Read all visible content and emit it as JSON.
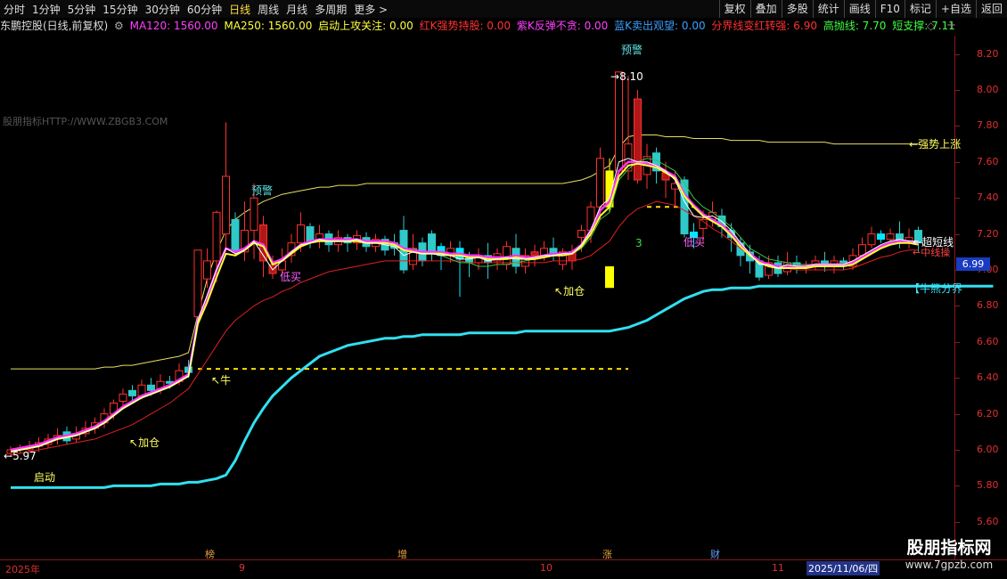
{
  "toolbar": {
    "periods": [
      "分时",
      "1分钟",
      "5分钟",
      "15分钟",
      "30分钟",
      "60分钟",
      "日线",
      "周线",
      "月线",
      "多周期",
      "更多"
    ],
    "active_period": "日线",
    "right_buttons": [
      "复权",
      "叠加",
      "多股",
      "统计",
      "画线",
      "F10",
      "标记",
      "+自选",
      "返回"
    ]
  },
  "info": {
    "symbol": "东鹏控股(日线,前复权)",
    "ma120": "MA120: 1560.00",
    "ma250": "MA250: 1560.00",
    "qidong": "启动上攻关注: 0.00",
    "hongk": "红K强势持股: 0.00",
    "zik": "紫K反弹不贪: 0.00",
    "lank": "蓝K卖出观望: 0.00",
    "fenjie": "分界线变红转强: 6.90",
    "gaopao": "高抛线: 7.70",
    "duanzhi": "短支撑: 7.11",
    "colors": {
      "ma120": "#ff40ff",
      "ma250": "#ffff40",
      "qidong": "#ffff40",
      "hongk": "#ff3030",
      "zik": "#ff40ff",
      "lank": "#3aa0ff",
      "fenjie": "#ff3030",
      "gaopao": "#40ff40",
      "duanzhi": "#40ff40"
    }
  },
  "watermark": "股朋指标HTTP://WWW.ZBGB3.COM",
  "price_tag": "6.99",
  "x_labels": [
    "2025年",
    "9",
    "10",
    "11"
  ],
  "date_label": "2025/11/06/四",
  "events": [
    "榜",
    "增",
    "涨",
    "财"
  ],
  "annotations": {
    "yujing1": "预警",
    "yujing2": "预警",
    "dimai1": "低买",
    "dimai2": "低买",
    "jiacang1": "加仓",
    "jiacang2": "加仓",
    "niu": "牛",
    "qidong": "启动",
    "low_price": "5.97",
    "high_price": "8.10",
    "three": "3",
    "qiangshi": "强势上涨",
    "chaoduan": "超短线",
    "zhongxian": "中线操",
    "niuxiong": "牛熊分界"
  },
  "logo": {
    "line1": "股朋指标网",
    "line2": "www.7gpzb.com"
  },
  "chart_data": {
    "type": "candlestick",
    "ylim": [
      5.55,
      8.3
    ],
    "yticks": [
      "8.20",
      "8.00",
      "7.80",
      "7.60",
      "7.40",
      "7.20",
      "7.00",
      "6.80",
      "6.60",
      "6.40",
      "6.20",
      "6.00",
      "5.80",
      "5.60"
    ],
    "candles": [
      [
        5.98,
        6.0,
        5.96,
        6.02
      ],
      [
        6.0,
        6.01,
        5.98,
        6.03
      ],
      [
        6.0,
        6.02,
        5.98,
        6.05
      ],
      [
        6.02,
        6.04,
        5.99,
        6.07
      ],
      [
        6.03,
        6.06,
        6.01,
        6.09
      ],
      [
        6.06,
        6.08,
        6.03,
        6.12
      ],
      [
        6.1,
        6.05,
        6.03,
        6.13
      ],
      [
        6.06,
        6.09,
        6.04,
        6.13
      ],
      [
        6.09,
        6.12,
        6.07,
        6.16
      ],
      [
        6.12,
        6.15,
        6.09,
        6.18
      ],
      [
        6.15,
        6.2,
        6.12,
        6.23
      ],
      [
        6.2,
        6.26,
        6.17,
        6.28
      ],
      [
        6.27,
        6.31,
        6.24,
        6.34
      ],
      [
        6.33,
        6.3,
        6.27,
        6.36
      ],
      [
        6.3,
        6.36,
        6.28,
        6.39
      ],
      [
        6.36,
        6.33,
        6.3,
        6.4
      ],
      [
        6.34,
        6.38,
        6.31,
        6.42
      ],
      [
        6.38,
        6.37,
        6.34,
        6.41
      ],
      [
        6.38,
        6.44,
        6.36,
        6.48
      ],
      [
        6.46,
        6.43,
        6.4,
        6.5
      ],
      [
        6.74,
        7.11,
        6.74,
        7.11
      ],
      [
        6.95,
        7.05,
        6.9,
        7.12
      ],
      [
        7.05,
        7.32,
        6.93,
        7.33
      ],
      [
        7.2,
        7.52,
        7.1,
        7.82
      ],
      [
        7.28,
        7.11,
        7.08,
        7.32
      ],
      [
        7.1,
        7.22,
        7.05,
        7.38
      ],
      [
        7.22,
        7.4,
        7.06,
        7.48
      ],
      [
        7.25,
        7.05,
        6.96,
        7.3
      ],
      [
        7.03,
        6.98,
        6.95,
        7.08
      ],
      [
        7.0,
        7.05,
        6.97,
        7.12
      ],
      [
        7.08,
        7.15,
        7.04,
        7.2
      ],
      [
        7.15,
        7.25,
        7.1,
        7.32
      ],
      [
        7.24,
        7.16,
        7.12,
        7.26
      ],
      [
        7.16,
        7.2,
        7.12,
        7.25
      ],
      [
        7.2,
        7.14,
        7.1,
        7.22
      ],
      [
        7.14,
        7.18,
        7.1,
        7.22
      ],
      [
        7.18,
        7.15,
        7.1,
        7.2
      ],
      [
        7.15,
        7.19,
        7.11,
        7.22
      ],
      [
        7.18,
        7.13,
        7.1,
        7.21
      ],
      [
        7.13,
        7.17,
        7.1,
        7.2
      ],
      [
        7.17,
        7.11,
        7.08,
        7.19
      ],
      [
        7.15,
        7.12,
        7.08,
        7.2
      ],
      [
        7.22,
        7.0,
        6.98,
        7.3
      ],
      [
        7.03,
        7.12,
        7.0,
        7.2
      ],
      [
        7.15,
        7.05,
        7.02,
        7.18
      ],
      [
        7.2,
        7.1,
        7.05,
        7.22
      ],
      [
        7.13,
        7.08,
        7.0,
        7.15
      ],
      [
        7.08,
        7.12,
        7.04,
        7.16
      ],
      [
        7.12,
        7.06,
        6.85,
        7.16
      ],
      [
        7.08,
        7.04,
        6.96,
        7.1
      ],
      [
        7.04,
        7.08,
        7.0,
        7.12
      ],
      [
        7.08,
        7.04,
        6.95,
        7.15
      ],
      [
        7.05,
        7.09,
        7.0,
        7.12
      ],
      [
        7.03,
        7.13,
        7.0,
        7.16
      ],
      [
        7.12,
        7.02,
        6.98,
        7.2
      ],
      [
        7.02,
        7.08,
        6.98,
        7.12
      ],
      [
        7.1,
        7.08,
        7.02,
        7.14
      ],
      [
        7.08,
        7.12,
        7.05,
        7.16
      ],
      [
        7.12,
        7.08,
        7.05,
        7.18
      ],
      [
        7.03,
        7.1,
        7.0,
        7.12
      ],
      [
        7.05,
        7.1,
        7.0,
        7.14
      ],
      [
        7.18,
        7.22,
        7.1,
        7.25
      ],
      [
        7.22,
        7.35,
        7.15,
        7.38
      ],
      [
        7.35,
        7.62,
        7.28,
        7.68
      ],
      [
        7.35,
        7.55,
        7.32,
        7.62
      ],
      [
        7.55,
        8.1,
        7.52,
        8.1
      ],
      [
        7.55,
        7.7,
        7.5,
        8.08
      ],
      [
        7.95,
        7.5,
        7.48,
        8.0
      ],
      [
        7.53,
        7.63,
        7.45,
        7.7
      ],
      [
        7.65,
        7.55,
        7.48,
        7.68
      ],
      [
        7.5,
        7.54,
        7.4,
        7.6
      ],
      [
        7.45,
        7.48,
        7.35,
        7.55
      ],
      [
        7.5,
        7.2,
        7.18,
        7.52
      ],
      [
        7.21,
        7.18,
        7.12,
        7.26
      ],
      [
        7.23,
        7.28,
        7.15,
        7.33
      ],
      [
        7.28,
        7.32,
        7.24,
        7.38
      ],
      [
        7.3,
        7.24,
        7.18,
        7.34
      ],
      [
        7.22,
        7.18,
        7.1,
        7.26
      ],
      [
        7.15,
        7.08,
        7.02,
        7.18
      ],
      [
        7.1,
        7.05,
        6.98,
        7.14
      ],
      [
        7.05,
        6.96,
        6.94,
        7.08
      ],
      [
        6.97,
        7.04,
        6.95,
        7.08
      ],
      [
        7.04,
        6.98,
        6.96,
        7.08
      ],
      [
        6.99,
        7.04,
        6.97,
        7.1
      ],
      [
        7.04,
        7.01,
        6.98,
        7.08
      ],
      [
        7.01,
        7.02,
        6.98,
        7.05
      ],
      [
        7.02,
        7.05,
        7.0,
        7.08
      ],
      [
        7.05,
        7.03,
        6.99,
        7.1
      ],
      [
        7.03,
        7.05,
        6.98,
        7.08
      ],
      [
        7.05,
        7.04,
        7.0,
        7.07
      ],
      [
        7.02,
        7.08,
        7.0,
        7.12
      ],
      [
        7.08,
        7.14,
        7.06,
        7.18
      ],
      [
        7.14,
        7.2,
        7.12,
        7.24
      ],
      [
        7.2,
        7.17,
        7.15,
        7.22
      ],
      [
        7.17,
        7.2,
        7.14,
        7.23
      ],
      [
        7.2,
        7.15,
        7.12,
        7.27
      ],
      [
        7.15,
        7.18,
        7.12,
        7.23
      ],
      [
        7.22,
        7.15,
        7.1,
        7.24
      ]
    ],
    "colored": {
      "cyan": [
        46,
        48,
        73,
        93
      ],
      "red": [
        27,
        28,
        56,
        60,
        67,
        70
      ],
      "yellow": [
        64
      ]
    },
    "lines": {
      "magenta": [
        6.0,
        6.01,
        6.02,
        6.03,
        6.05,
        6.07,
        6.08,
        6.09,
        6.11,
        6.13,
        6.16,
        6.2,
        6.24,
        6.27,
        6.3,
        6.32,
        6.34,
        6.36,
        6.39,
        6.42,
        6.72,
        6.85,
        7.0,
        7.12,
        7.1,
        7.12,
        7.16,
        7.14,
        7.04,
        7.06,
        7.1,
        7.14,
        7.16,
        7.17,
        7.17,
        7.17,
        7.17,
        7.17,
        7.16,
        7.16,
        7.16,
        7.15,
        7.12,
        7.11,
        7.1,
        7.1,
        7.1,
        7.09,
        7.09,
        7.08,
        7.08,
        7.07,
        7.07,
        7.07,
        7.08,
        7.07,
        7.07,
        7.08,
        7.09,
        7.09,
        7.1,
        7.14,
        7.22,
        7.33,
        7.38,
        7.55,
        7.6,
        7.6,
        7.59,
        7.58,
        7.55,
        7.52,
        7.42,
        7.36,
        7.31,
        7.28,
        7.25,
        7.2,
        7.14,
        7.09,
        7.05,
        7.03,
        7.02,
        7.02,
        7.02,
        7.02,
        7.03,
        7.03,
        7.03,
        7.03,
        7.04,
        7.07,
        7.1,
        7.13,
        7.15,
        7.16,
        7.16,
        7.15
      ],
      "yellow": [
        5.99,
        6.0,
        6.01,
        6.02,
        6.04,
        6.06,
        6.07,
        6.08,
        6.1,
        6.12,
        6.15,
        6.19,
        6.23,
        6.26,
        6.29,
        6.31,
        6.33,
        6.35,
        6.38,
        6.41,
        6.7,
        6.82,
        6.96,
        7.09,
        7.08,
        7.11,
        7.15,
        7.13,
        7.03,
        7.05,
        7.09,
        7.13,
        7.15,
        7.16,
        7.16,
        7.16,
        7.16,
        7.16,
        7.15,
        7.15,
        7.15,
        7.14,
        7.11,
        7.1,
        7.09,
        7.09,
        7.09,
        7.08,
        7.08,
        7.07,
        7.07,
        7.06,
        7.06,
        7.06,
        7.07,
        7.06,
        7.06,
        7.07,
        7.08,
        7.08,
        7.09,
        7.13,
        7.2,
        7.3,
        7.35,
        7.52,
        7.58,
        7.59,
        7.58,
        7.57,
        7.54,
        7.51,
        7.41,
        7.35,
        7.3,
        7.27,
        7.24,
        7.19,
        7.13,
        7.08,
        7.04,
        7.02,
        7.01,
        7.01,
        7.01,
        7.01,
        7.02,
        7.02,
        7.02,
        7.02,
        7.03,
        7.06,
        7.09,
        7.12,
        7.14,
        7.15,
        7.15,
        7.14
      ],
      "white": [
        5.99,
        6.0,
        6.01,
        6.02,
        6.04,
        6.06,
        6.07,
        6.08,
        6.1,
        6.12,
        6.15,
        6.19,
        6.23,
        6.26,
        6.29,
        6.31,
        6.33,
        6.35,
        6.38,
        6.41,
        6.72,
        6.86,
        7.0,
        7.12,
        7.09,
        7.11,
        7.16,
        7.08,
        7.0,
        7.05,
        7.1,
        7.14,
        7.15,
        7.17,
        7.16,
        7.16,
        7.16,
        7.17,
        7.15,
        7.15,
        7.14,
        7.13,
        7.08,
        7.1,
        7.09,
        7.09,
        7.08,
        7.08,
        7.06,
        7.06,
        7.07,
        7.05,
        7.06,
        7.07,
        7.06,
        7.06,
        7.07,
        7.08,
        7.08,
        7.09,
        7.09,
        7.14,
        7.22,
        7.35,
        7.4,
        7.6,
        7.62,
        7.6,
        7.6,
        7.58,
        7.55,
        7.5,
        7.38,
        7.3,
        7.29,
        7.3,
        7.27,
        7.22,
        7.15,
        7.09,
        7.03,
        7.03,
        7.01,
        7.03,
        7.02,
        7.02,
        7.03,
        7.03,
        7.03,
        7.03,
        7.05,
        7.08,
        7.11,
        7.14,
        7.16,
        7.17,
        7.16,
        7.16
      ],
      "green": [
        null,
        null,
        null,
        null,
        null,
        null,
        null,
        null,
        null,
        null,
        null,
        null,
        null,
        null,
        null,
        null,
        null,
        null,
        null,
        null,
        null,
        null,
        null,
        null,
        null,
        null,
        null,
        null,
        null,
        null,
        null,
        null,
        null,
        null,
        null,
        null,
        null,
        null,
        null,
        null,
        null,
        null,
        null,
        7.12,
        7.1,
        7.09,
        7.08,
        7.06,
        7.04,
        7.04,
        7.02,
        7.02,
        7.03,
        7.03,
        7.04,
        7.05,
        7.06,
        7.07,
        7.08,
        7.08,
        7.09,
        7.12,
        7.18,
        7.28,
        7.32,
        7.5,
        7.56,
        7.6,
        7.62,
        7.61,
        7.58,
        7.55,
        7.48,
        7.4,
        7.35,
        7.32,
        7.28,
        7.24,
        7.18,
        7.12,
        7.09,
        7.06,
        7.05,
        7.04,
        7.03,
        7.03,
        7.03,
        7.03,
        7.03,
        7.03,
        7.04,
        7.06,
        7.09,
        7.12,
        7.14,
        7.15,
        7.15,
        7.14
      ],
      "red": [
        5.97,
        5.98,
        5.99,
        6.0,
        6.01,
        6.02,
        6.03,
        6.04,
        6.05,
        6.06,
        6.08,
        6.1,
        6.12,
        6.14,
        6.17,
        6.2,
        6.23,
        6.26,
        6.3,
        6.34,
        6.42,
        6.5,
        6.58,
        6.66,
        6.72,
        6.76,
        6.8,
        6.83,
        6.85,
        6.88,
        6.9,
        6.93,
        6.95,
        6.97,
        6.99,
        7.0,
        7.01,
        7.02,
        7.03,
        7.04,
        7.05,
        7.05,
        7.05,
        7.05,
        7.05,
        7.05,
        7.05,
        7.05,
        7.05,
        7.04,
        7.04,
        7.04,
        7.04,
        7.04,
        7.04,
        7.04,
        7.04,
        7.04,
        7.05,
        7.05,
        7.05,
        7.06,
        7.08,
        7.12,
        7.16,
        7.24,
        7.3,
        7.34,
        7.36,
        7.38,
        7.37,
        7.36,
        7.33,
        7.3,
        7.27,
        7.23,
        7.2,
        7.16,
        7.12,
        7.08,
        7.05,
        7.03,
        7.02,
        7.01,
        7.0,
        7.0,
        7.0,
        7.0,
        7.0,
        7.0,
        7.01,
        7.03,
        7.05,
        7.07,
        7.08,
        7.1,
        7.11,
        7.11
      ],
      "upper_yellow": [
        6.45,
        6.45,
        6.45,
        6.45,
        6.45,
        6.45,
        6.45,
        6.45,
        6.45,
        6.45,
        6.46,
        6.46,
        6.47,
        6.47,
        6.48,
        6.49,
        6.5,
        6.51,
        6.52,
        6.54,
        6.75,
        6.95,
        7.1,
        7.22,
        7.28,
        7.32,
        7.35,
        7.38,
        7.4,
        7.42,
        7.43,
        7.44,
        7.45,
        7.46,
        7.46,
        7.47,
        7.47,
        7.47,
        7.48,
        7.48,
        7.48,
        7.48,
        7.48,
        7.48,
        7.48,
        7.48,
        7.48,
        7.48,
        7.48,
        7.48,
        7.48,
        7.48,
        7.48,
        7.48,
        7.48,
        7.48,
        7.48,
        7.48,
        7.48,
        7.48,
        7.49,
        7.5,
        7.52,
        7.55,
        7.58,
        7.68,
        7.74,
        7.75,
        7.75,
        7.75,
        7.74,
        7.74,
        7.74,
        7.73,
        7.73,
        7.73,
        7.73,
        7.72,
        7.72,
        7.72,
        7.72,
        7.71,
        7.71,
        7.71,
        7.71,
        7.71,
        7.71,
        7.71,
        7.7,
        7.7,
        7.7,
        7.7,
        7.7,
        7.7,
        7.7,
        7.7,
        7.7,
        7.7
      ],
      "cyan": [
        5.79,
        5.79,
        5.79,
        5.79,
        5.79,
        5.79,
        5.79,
        5.79,
        5.79,
        5.79,
        5.79,
        5.8,
        5.8,
        5.8,
        5.8,
        5.8,
        5.81,
        5.81,
        5.81,
        5.82,
        5.82,
        5.83,
        5.84,
        5.86,
        5.94,
        6.05,
        6.15,
        6.23,
        6.3,
        6.35,
        6.4,
        6.44,
        6.48,
        6.52,
        6.54,
        6.56,
        6.58,
        6.59,
        6.6,
        6.61,
        6.62,
        6.62,
        6.63,
        6.63,
        6.64,
        6.64,
        6.64,
        6.64,
        6.64,
        6.65,
        6.65,
        6.65,
        6.65,
        6.65,
        6.65,
        6.66,
        6.66,
        6.66,
        6.66,
        6.66,
        6.66,
        6.66,
        6.66,
        6.66,
        6.66,
        6.67,
        6.68,
        6.7,
        6.72,
        6.75,
        6.78,
        6.81,
        6.84,
        6.86,
        6.88,
        6.89,
        6.89,
        6.9,
        6.9,
        6.9,
        6.91,
        6.91,
        6.91,
        6.91,
        6.91,
        6.91,
        6.91,
        6.91,
        6.91,
        6.91,
        6.91,
        6.91,
        6.91,
        6.91,
        6.91,
        6.91,
        6.91,
        6.91
      ]
    },
    "dashed_lines": [
      {
        "value": 6.45,
        "from": 20,
        "to": 66,
        "color": "#ffdd00"
      },
      {
        "value": 7.35,
        "from": 68,
        "to": 73,
        "color": "#ffdd00"
      }
    ],
    "signal_marks": [
      {
        "index": 64,
        "low": 6.9,
        "high": 7.02,
        "color": "#ffff00"
      }
    ]
  }
}
